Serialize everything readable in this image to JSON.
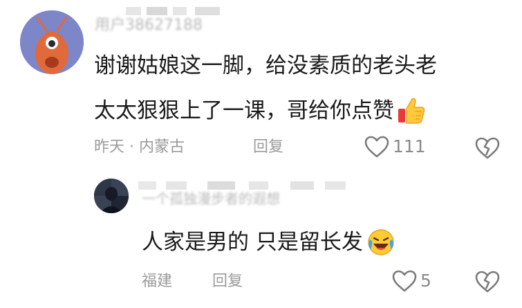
{
  "comment": {
    "username": "用户38627188",
    "text_line1": "谢谢姑娘这一脚，给没素质的老头老",
    "text_line2": "太太狠狠上了一课，哥给你点赞",
    "meta": "昨天 · 内蒙古",
    "reply_label": "回复",
    "like_count": "111",
    "icons": [
      "avatar-shrimp",
      "thumbs-up-emoji",
      "heart-icon",
      "broken-heart-icon"
    ]
  },
  "reply": {
    "username": "一个孤独漫步者的遐想",
    "text": "人家是男的 只是留长发",
    "meta": "福建",
    "reply_label": "回复",
    "like_count": "5",
    "icons": [
      "avatar-dark",
      "laughing-tears-emoji",
      "heart-icon",
      "broken-heart-icon"
    ]
  },
  "colors": {
    "text": "#1a1a1a",
    "meta": "#9a9a9a",
    "avatar_main_bg": "#7d86c9"
  }
}
